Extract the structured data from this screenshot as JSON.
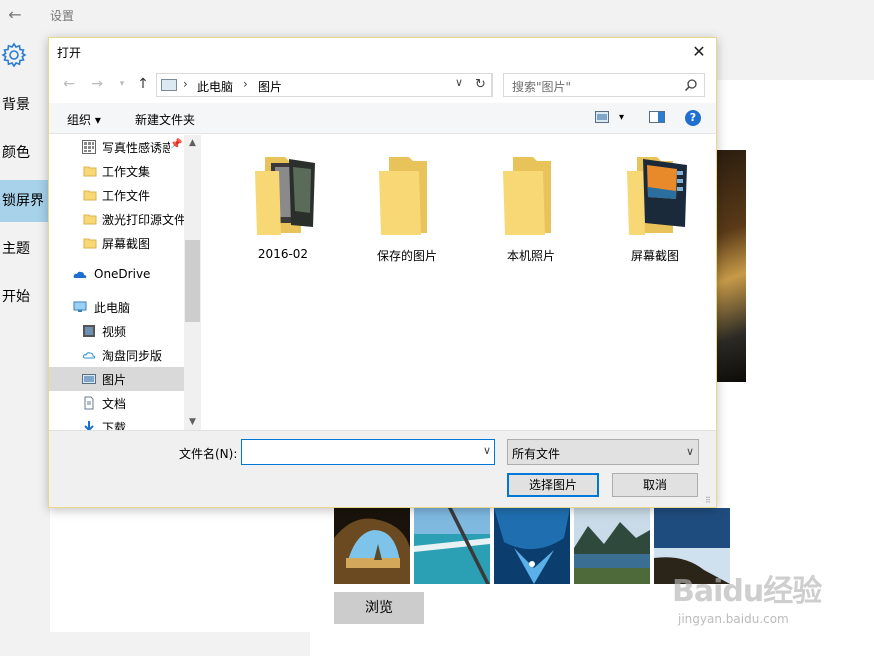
{
  "settings": {
    "title": "设置",
    "nav": [
      "背景",
      "颜色",
      "锁屏界",
      "主题",
      "开始"
    ],
    "selected_nav_index": 2,
    "browse_label": "浏览"
  },
  "dialog": {
    "title": "打开",
    "close_glyph": "✕",
    "address": {
      "segments": [
        "此电脑",
        "图片"
      ]
    },
    "search_placeholder": "搜索\"图片\"",
    "commands": {
      "organize": "组织 ▾",
      "new_folder": "新建文件夹"
    },
    "help_glyph": "?",
    "tree": [
      {
        "label": "写真性感诱惑",
        "icon": "grid-folder-icon",
        "indent": 1,
        "pinned": true
      },
      {
        "label": "工作文集",
        "icon": "folder-icon",
        "indent": 1
      },
      {
        "label": "工作文件",
        "icon": "folder-icon",
        "indent": 1
      },
      {
        "label": "激光打印源文件",
        "icon": "folder-icon",
        "indent": 1
      },
      {
        "label": "屏幕截图",
        "icon": "folder-icon",
        "indent": 1
      },
      {
        "label": "OneDrive",
        "icon": "onedrive-icon",
        "indent": 0
      },
      {
        "label": "此电脑",
        "icon": "pc-icon",
        "indent": 0
      },
      {
        "label": "视频",
        "icon": "video-icon",
        "indent": 1
      },
      {
        "label": "淘盘同步版",
        "icon": "cloud-icon",
        "indent": 1
      },
      {
        "label": "图片",
        "icon": "pictures-icon",
        "indent": 1,
        "selected": true
      },
      {
        "label": "文档",
        "icon": "document-icon",
        "indent": 1
      },
      {
        "label": "下载",
        "icon": "download-icon",
        "indent": 1
      }
    ],
    "folders": [
      {
        "name": "2016-02",
        "preview": "photo"
      },
      {
        "name": "保存的图片",
        "preview": "empty"
      },
      {
        "name": "本机照片",
        "preview": "empty"
      },
      {
        "name": "屏幕截图",
        "preview": "screenshot"
      }
    ],
    "filename_label": "文件名(N):",
    "filename_value": "",
    "filetype_value": "所有文件",
    "primary_button": "选择图片",
    "cancel_button": "取消"
  },
  "watermark": {
    "logo": "Baidu经验",
    "url": "jingyan.baidu.com"
  },
  "colors": {
    "accent": "#0078d7",
    "selected_nav": "#a7d2ea",
    "folder": "#f8d775"
  }
}
